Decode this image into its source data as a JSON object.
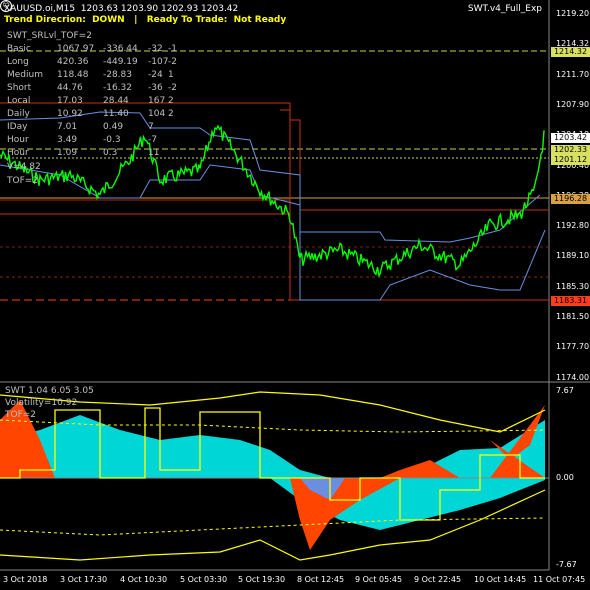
{
  "header": {
    "symbol_line": "XAUUSD.oi,M15  1203.63 1203.90 1202.93 1203.42",
    "trend_line": "Trend Direcrion:  DOWN   |   Ready To Trade:  Not Ready",
    "expert": "SWT.v4_Full_Exp",
    "sr_level": "SWT_SRLvl_TOF=2"
  },
  "table": {
    "rows": [
      [
        "Basic",
        "1067.97",
        "-336.44",
        "-32",
        "-1"
      ],
      [
        "Long",
        "420.36",
        "-449.19",
        "-107",
        "-2"
      ],
      [
        "Medium",
        "118.48",
        "-28.83",
        "-24",
        "1"
      ],
      [
        "Short",
        "44.76",
        "-16.32",
        "-36",
        "-2"
      ],
      [
        "Local",
        "17.03",
        "28.44",
        "167",
        "2"
      ],
      [
        "Daily",
        "10.92",
        "11.40",
        "104",
        "2"
      ],
      [
        "IDay",
        "7.01",
        "0.49",
        "7",
        ""
      ],
      [
        "Hour",
        "3.49",
        "-0.3",
        "-7",
        ""
      ],
      [
        "Hour",
        "1.09",
        "0.3",
        "11",
        ""
      ]
    ],
    "v_line": "V=4.82",
    "tof_line": "TOF=2"
  },
  "price_axis": {
    "ticks": [
      "1219.20",
      "1214.32",
      "1211.70",
      "1207.90",
      "1204.10",
      "1200.40",
      "1196.28",
      "1192.80",
      "1189.10",
      "1185.30",
      "1181.50",
      "1177.70",
      "1174.00"
    ],
    "boxes": [
      {
        "label": "1214.32",
        "color": "#d8e060"
      },
      {
        "label": "1203.42",
        "color": "#ffffff"
      },
      {
        "label": "1202.33",
        "color": "#d8e060"
      },
      {
        "label": "1201.12",
        "color": "#d8e060"
      },
      {
        "label": "1196.28",
        "color": "#d8a040"
      },
      {
        "label": "1183.31",
        "color": "#ff3c1e"
      }
    ]
  },
  "indicator": {
    "title": "SWT 1.04 6.05 3.05",
    "volatility": "Volatility=10.92",
    "tof": "TOF=2",
    "ticks": [
      "7.67",
      "0.00",
      "-7.67"
    ]
  },
  "time_axis": [
    "3 Oct 2018",
    "3 Oct 17:30",
    "4 Oct 10:30",
    "5 Oct 03:30",
    "5 Oct 19:30",
    "8 Oct 12:45",
    "9 Oct 05:45",
    "9 Oct 22:45",
    "10 Oct 14:45",
    "11 Oct 07:45"
  ],
  "colors": {
    "price": "#00ff00",
    "upper": "#ffff00",
    "cyan": "#00d6d6",
    "orange": "#ff4500",
    "blue": "#6a8fe0"
  }
}
